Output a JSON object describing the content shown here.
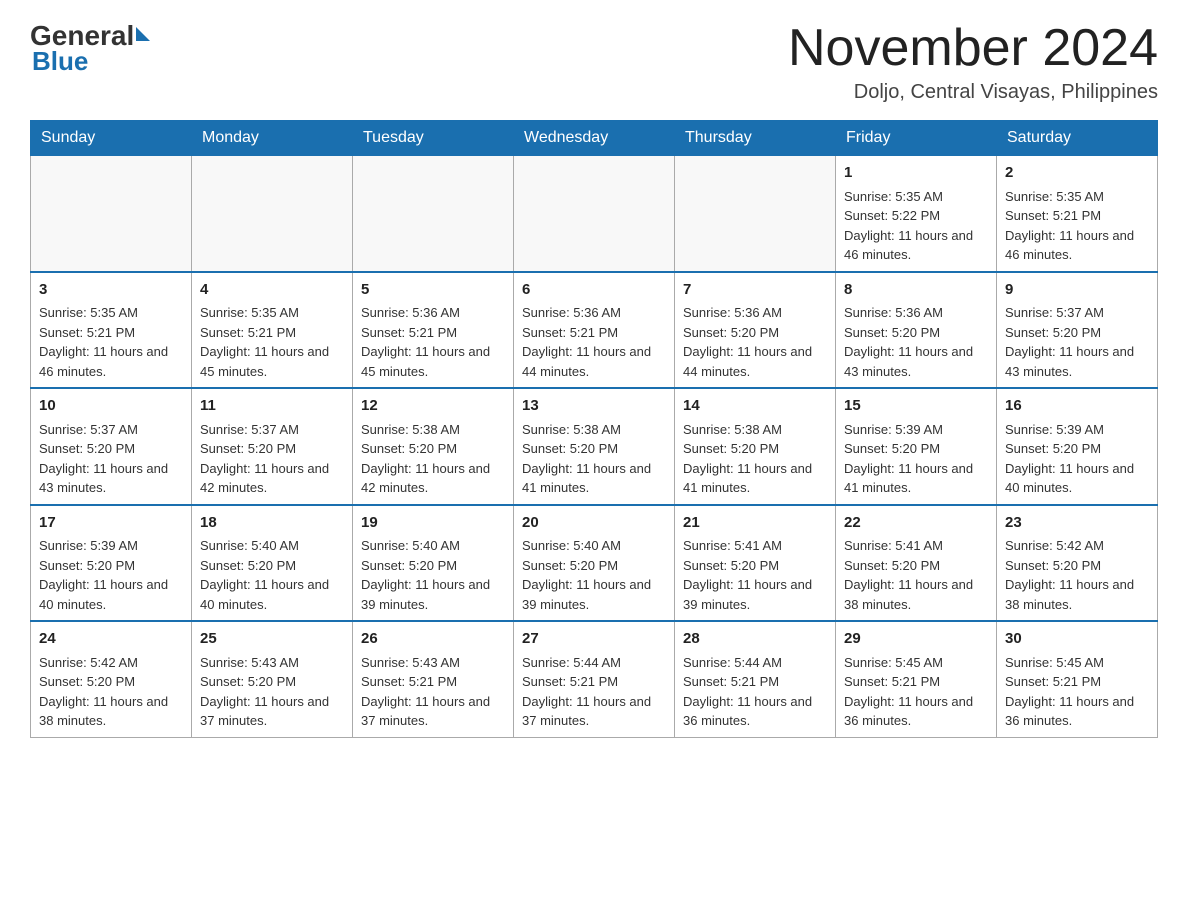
{
  "header": {
    "logo_general": "General",
    "logo_blue": "Blue",
    "month_title": "November 2024",
    "location": "Doljo, Central Visayas, Philippines"
  },
  "weekdays": [
    "Sunday",
    "Monday",
    "Tuesday",
    "Wednesday",
    "Thursday",
    "Friday",
    "Saturday"
  ],
  "weeks": [
    [
      {
        "day": "",
        "info": ""
      },
      {
        "day": "",
        "info": ""
      },
      {
        "day": "",
        "info": ""
      },
      {
        "day": "",
        "info": ""
      },
      {
        "day": "",
        "info": ""
      },
      {
        "day": "1",
        "info": "Sunrise: 5:35 AM\nSunset: 5:22 PM\nDaylight: 11 hours and 46 minutes."
      },
      {
        "day": "2",
        "info": "Sunrise: 5:35 AM\nSunset: 5:21 PM\nDaylight: 11 hours and 46 minutes."
      }
    ],
    [
      {
        "day": "3",
        "info": "Sunrise: 5:35 AM\nSunset: 5:21 PM\nDaylight: 11 hours and 46 minutes."
      },
      {
        "day": "4",
        "info": "Sunrise: 5:35 AM\nSunset: 5:21 PM\nDaylight: 11 hours and 45 minutes."
      },
      {
        "day": "5",
        "info": "Sunrise: 5:36 AM\nSunset: 5:21 PM\nDaylight: 11 hours and 45 minutes."
      },
      {
        "day": "6",
        "info": "Sunrise: 5:36 AM\nSunset: 5:21 PM\nDaylight: 11 hours and 44 minutes."
      },
      {
        "day": "7",
        "info": "Sunrise: 5:36 AM\nSunset: 5:20 PM\nDaylight: 11 hours and 44 minutes."
      },
      {
        "day": "8",
        "info": "Sunrise: 5:36 AM\nSunset: 5:20 PM\nDaylight: 11 hours and 43 minutes."
      },
      {
        "day": "9",
        "info": "Sunrise: 5:37 AM\nSunset: 5:20 PM\nDaylight: 11 hours and 43 minutes."
      }
    ],
    [
      {
        "day": "10",
        "info": "Sunrise: 5:37 AM\nSunset: 5:20 PM\nDaylight: 11 hours and 43 minutes."
      },
      {
        "day": "11",
        "info": "Sunrise: 5:37 AM\nSunset: 5:20 PM\nDaylight: 11 hours and 42 minutes."
      },
      {
        "day": "12",
        "info": "Sunrise: 5:38 AM\nSunset: 5:20 PM\nDaylight: 11 hours and 42 minutes."
      },
      {
        "day": "13",
        "info": "Sunrise: 5:38 AM\nSunset: 5:20 PM\nDaylight: 11 hours and 41 minutes."
      },
      {
        "day": "14",
        "info": "Sunrise: 5:38 AM\nSunset: 5:20 PM\nDaylight: 11 hours and 41 minutes."
      },
      {
        "day": "15",
        "info": "Sunrise: 5:39 AM\nSunset: 5:20 PM\nDaylight: 11 hours and 41 minutes."
      },
      {
        "day": "16",
        "info": "Sunrise: 5:39 AM\nSunset: 5:20 PM\nDaylight: 11 hours and 40 minutes."
      }
    ],
    [
      {
        "day": "17",
        "info": "Sunrise: 5:39 AM\nSunset: 5:20 PM\nDaylight: 11 hours and 40 minutes."
      },
      {
        "day": "18",
        "info": "Sunrise: 5:40 AM\nSunset: 5:20 PM\nDaylight: 11 hours and 40 minutes."
      },
      {
        "day": "19",
        "info": "Sunrise: 5:40 AM\nSunset: 5:20 PM\nDaylight: 11 hours and 39 minutes."
      },
      {
        "day": "20",
        "info": "Sunrise: 5:40 AM\nSunset: 5:20 PM\nDaylight: 11 hours and 39 minutes."
      },
      {
        "day": "21",
        "info": "Sunrise: 5:41 AM\nSunset: 5:20 PM\nDaylight: 11 hours and 39 minutes."
      },
      {
        "day": "22",
        "info": "Sunrise: 5:41 AM\nSunset: 5:20 PM\nDaylight: 11 hours and 38 minutes."
      },
      {
        "day": "23",
        "info": "Sunrise: 5:42 AM\nSunset: 5:20 PM\nDaylight: 11 hours and 38 minutes."
      }
    ],
    [
      {
        "day": "24",
        "info": "Sunrise: 5:42 AM\nSunset: 5:20 PM\nDaylight: 11 hours and 38 minutes."
      },
      {
        "day": "25",
        "info": "Sunrise: 5:43 AM\nSunset: 5:20 PM\nDaylight: 11 hours and 37 minutes."
      },
      {
        "day": "26",
        "info": "Sunrise: 5:43 AM\nSunset: 5:21 PM\nDaylight: 11 hours and 37 minutes."
      },
      {
        "day": "27",
        "info": "Sunrise: 5:44 AM\nSunset: 5:21 PM\nDaylight: 11 hours and 37 minutes."
      },
      {
        "day": "28",
        "info": "Sunrise: 5:44 AM\nSunset: 5:21 PM\nDaylight: 11 hours and 36 minutes."
      },
      {
        "day": "29",
        "info": "Sunrise: 5:45 AM\nSunset: 5:21 PM\nDaylight: 11 hours and 36 minutes."
      },
      {
        "day": "30",
        "info": "Sunrise: 5:45 AM\nSunset: 5:21 PM\nDaylight: 11 hours and 36 minutes."
      }
    ]
  ]
}
